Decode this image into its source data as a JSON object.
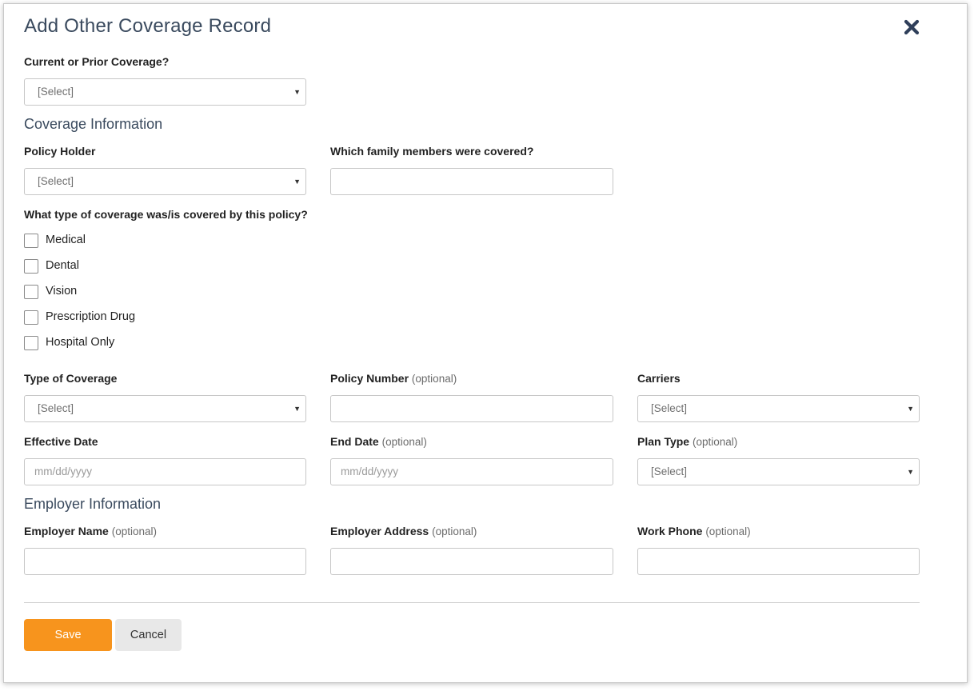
{
  "modal": {
    "title": "Add Other Coverage Record",
    "close_icon": "close-x-icon"
  },
  "current_prior": {
    "label": "Current or Prior Coverage?",
    "value": "[Select]"
  },
  "coverage_info": {
    "heading": "Coverage Information",
    "policy_holder": {
      "label": "Policy Holder",
      "value": "[Select]"
    },
    "family_members": {
      "label": "Which family members were covered?",
      "value": ""
    },
    "coverage_types_question": "What type of coverage was/is covered by this policy?",
    "coverage_types": [
      {
        "label": "Medical",
        "checked": false
      },
      {
        "label": "Dental",
        "checked": false
      },
      {
        "label": "Vision",
        "checked": false
      },
      {
        "label": "Prescription Drug",
        "checked": false
      },
      {
        "label": "Hospital Only",
        "checked": false
      }
    ],
    "type_of_coverage": {
      "label": "Type of Coverage",
      "value": "[Select]"
    },
    "policy_number": {
      "label": "Policy Number",
      "optional": "(optional)",
      "value": ""
    },
    "carriers": {
      "label": "Carriers",
      "value": "[Select]"
    },
    "effective_date": {
      "label": "Effective Date",
      "placeholder": "mm/dd/yyyy"
    },
    "end_date": {
      "label": "End Date",
      "optional": "(optional)",
      "placeholder": "mm/dd/yyyy"
    },
    "plan_type": {
      "label": "Plan Type",
      "optional": "(optional)",
      "value": "[Select]"
    }
  },
  "employer_info": {
    "heading": "Employer Information",
    "employer_name": {
      "label": "Employer Name",
      "optional": "(optional)",
      "value": ""
    },
    "employer_address": {
      "label": "Employer Address",
      "optional": "(optional)",
      "value": ""
    },
    "work_phone": {
      "label": "Work Phone",
      "optional": "(optional)",
      "value": ""
    }
  },
  "actions": {
    "save_label": "Save",
    "cancel_label": "Cancel"
  },
  "colors": {
    "accent": "#f7941d",
    "heading": "#3a4a5e",
    "close": "#2f3f5a"
  }
}
